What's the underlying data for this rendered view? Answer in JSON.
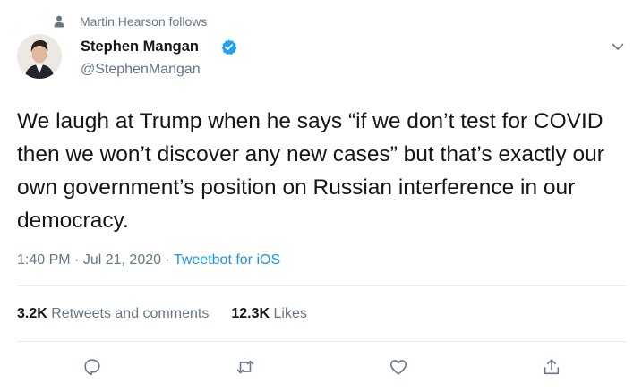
{
  "social_context": {
    "text": "Martin Hearson follows",
    "icon": "person-icon"
  },
  "author": {
    "display_name": "Stephen Mangan",
    "handle": "@StephenMangan",
    "verified": true
  },
  "tweet": {
    "text": "We laugh at Trump when he says “if we don’t test for COVID then we won’t discover any new cases” but that’s exactly our own government’s position on Russian interference in our democracy.",
    "time": "1:40 PM",
    "date": "Jul 21, 2020",
    "separator": "·",
    "source": "Tweetbot for iOS"
  },
  "stats": {
    "retweets_count": "3.2K",
    "retweets_label": "Retweets and comments",
    "likes_count": "12.3K",
    "likes_label": "Likes"
  },
  "actions": [
    "reply-icon",
    "retweet-icon",
    "like-icon",
    "share-icon"
  ],
  "colors": {
    "link": "#1b95e0",
    "verified": "#1da1f2",
    "secondary_text": "#657786",
    "primary_text": "#14171a",
    "divider": "#e6ecf0"
  }
}
